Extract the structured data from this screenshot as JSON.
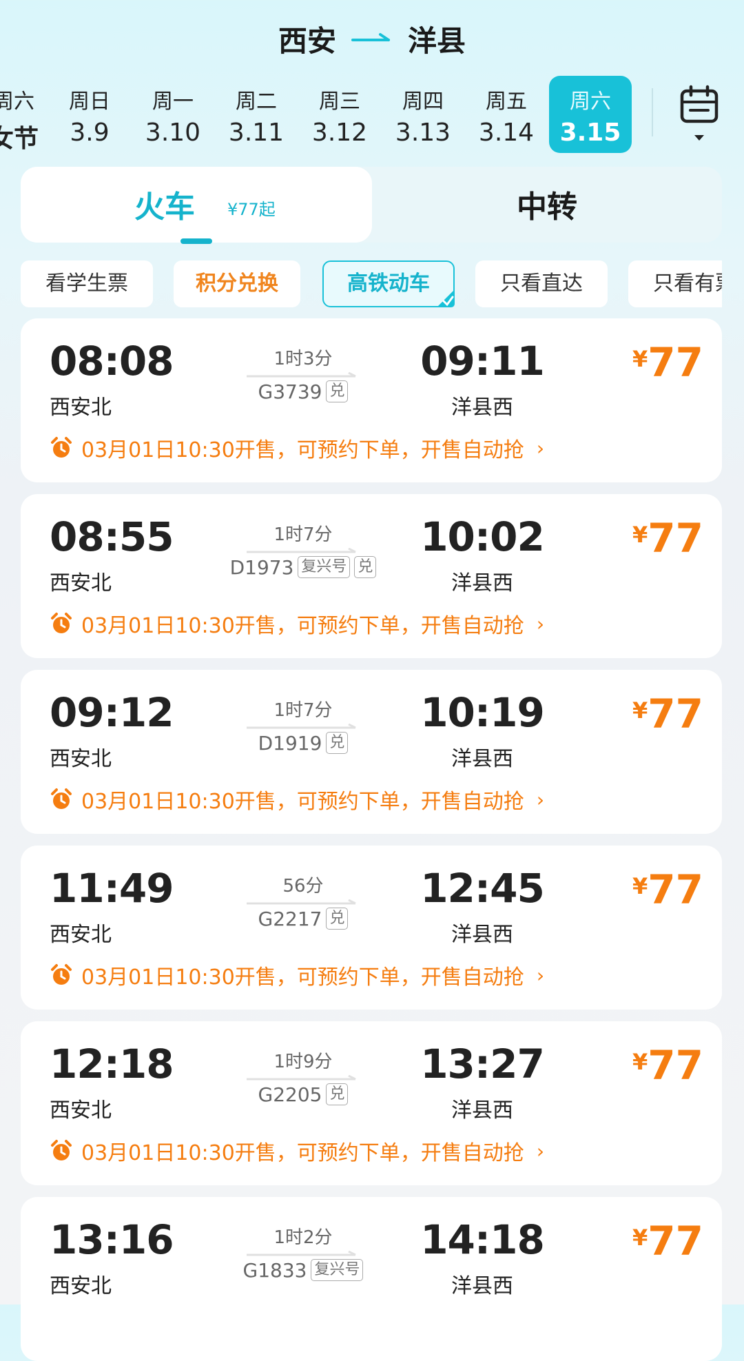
{
  "route": {
    "from": "西安",
    "to": "洋县"
  },
  "dates": [
    {
      "week": "周六",
      "date": "女节"
    },
    {
      "week": "周日",
      "date": "3.9"
    },
    {
      "week": "周一",
      "date": "3.10"
    },
    {
      "week": "周二",
      "date": "3.11"
    },
    {
      "week": "周三",
      "date": "3.12"
    },
    {
      "week": "周四",
      "date": "3.13"
    },
    {
      "week": "周五",
      "date": "3.14"
    },
    {
      "week": "周六",
      "date": "3.15"
    }
  ],
  "tabs": {
    "train": "火车",
    "train_price": "¥77起",
    "transfer": "中转"
  },
  "filters": [
    "看学生票",
    "积分兑换",
    "高铁动车",
    "只看直达",
    "只看有票"
  ],
  "currency": "¥",
  "trains": [
    {
      "dep": "08:08",
      "dep_station": "西安北",
      "duration": "1时3分",
      "no": "G3739",
      "tags": [
        "兑"
      ],
      "arr": "09:11",
      "arr_station": "洋县西",
      "price": "77",
      "notice": "03月01日10:30开售，可预约下单，开售自动抢"
    },
    {
      "dep": "08:55",
      "dep_station": "西安北",
      "duration": "1时7分",
      "no": "D1973",
      "tags": [
        "复兴号",
        "兑"
      ],
      "arr": "10:02",
      "arr_station": "洋县西",
      "price": "77",
      "notice": "03月01日10:30开售，可预约下单，开售自动抢"
    },
    {
      "dep": "09:12",
      "dep_station": "西安北",
      "duration": "1时7分",
      "no": "D1919",
      "tags": [
        "兑"
      ],
      "arr": "10:19",
      "arr_station": "洋县西",
      "price": "77",
      "notice": "03月01日10:30开售，可预约下单，开售自动抢"
    },
    {
      "dep": "11:49",
      "dep_station": "西安北",
      "duration": "56分",
      "no": "G2217",
      "tags": [
        "兑"
      ],
      "arr": "12:45",
      "arr_station": "洋县西",
      "price": "77",
      "notice": "03月01日10:30开售，可预约下单，开售自动抢"
    },
    {
      "dep": "12:18",
      "dep_station": "西安北",
      "duration": "1时9分",
      "no": "G2205",
      "tags": [
        "兑"
      ],
      "arr": "13:27",
      "arr_station": "洋县西",
      "price": "77",
      "notice": "03月01日10:30开售，可预约下单，开售自动抢"
    },
    {
      "dep": "13:16",
      "dep_station": "西安北",
      "duration": "1时2分",
      "no": "G1833",
      "tags": [
        "复兴号"
      ],
      "arr": "14:18",
      "arr_station": "洋县西",
      "price": "77",
      "notice": ""
    }
  ],
  "colors": {
    "accent": "#18c1d8",
    "price": "#f57d10"
  }
}
